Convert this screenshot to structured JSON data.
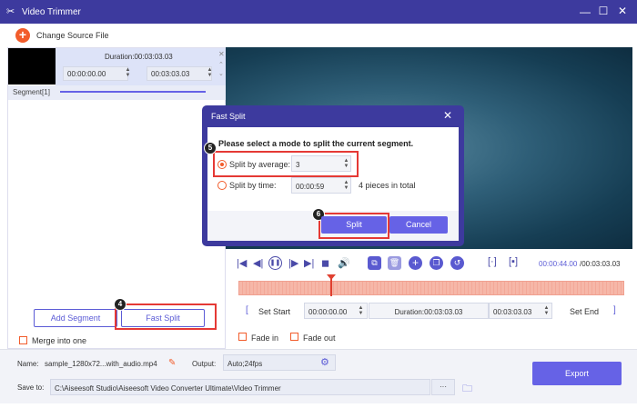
{
  "window": {
    "title": "Video Trimmer",
    "minimize_icon": "minimize-icon",
    "maximize_icon": "maximize-icon",
    "close_icon": "close-icon"
  },
  "toolbar": {
    "change_source_label": "Change Source File"
  },
  "segment": {
    "duration_label": "Duration:00:03:03.03",
    "start_value": "00:00:00.00",
    "end_value": "00:03:03.03",
    "label": "Segment[1]"
  },
  "left_actions": {
    "add_segment_label": "Add Segment",
    "fast_split_label": "Fast Split",
    "merge_label": "Merge into one"
  },
  "player": {
    "time_current": "00:00:44.00",
    "time_total": "/00:03:03.03",
    "set_start_label": "Set Start",
    "start_value": "00:00:00.00",
    "duration_label": "Duration:00:03:03.03",
    "end_value": "00:03:03.03",
    "set_end_label": "Set End",
    "fade_in_label": "Fade in",
    "fade_out_label": "Fade out"
  },
  "dialog": {
    "title": "Fast Split",
    "prompt": "Please select a mode to split the current segment.",
    "option_average_label": "Split by average:",
    "average_value": "3",
    "option_time_label": "Split by time:",
    "time_value": "00:00:59",
    "pieces_label": "4 pieces in total",
    "split_label": "Split",
    "cancel_label": "Cancel"
  },
  "bottom": {
    "name_label": "Name:",
    "name_value": "sample_1280x72...with_audio.mp4",
    "output_label": "Output:",
    "output_value": "Auto;24fps",
    "save_label": "Save to:",
    "save_path": "C:\\Aiseesoft Studio\\Aiseesoft Video Converter Ultimate\\Video Trimmer",
    "browse_label": "···",
    "export_label": "Export"
  },
  "badges": {
    "b4": "4",
    "b5": "5",
    "b6": "6"
  },
  "colors": {
    "titlebar": "#3d3a9e",
    "accent": "#6662e6",
    "orange": "#f25c2b",
    "highlight": "#e53935"
  }
}
